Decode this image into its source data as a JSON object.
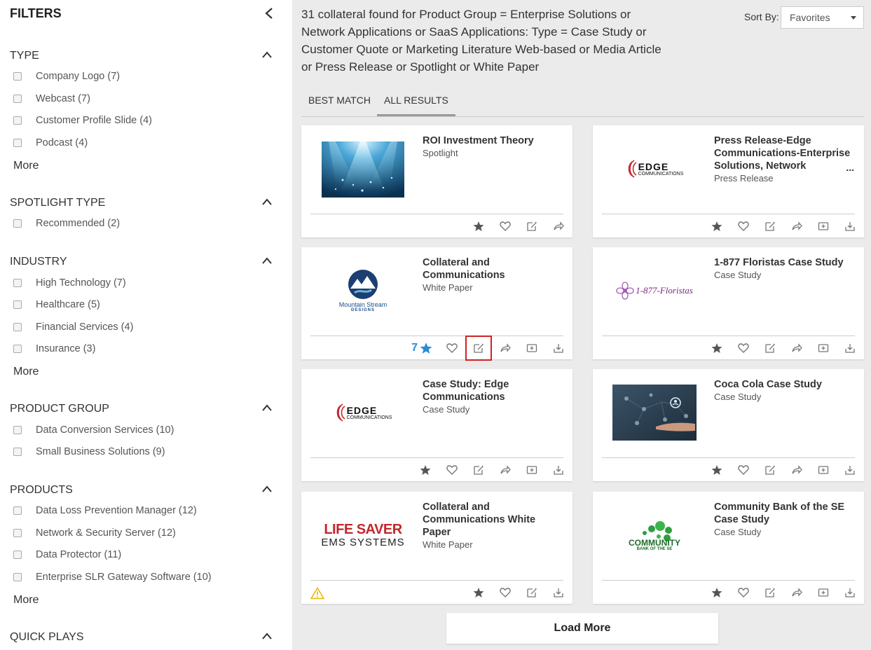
{
  "sidebar": {
    "title": "FILTERS",
    "more_label": "More",
    "sections": [
      {
        "title": "TYPE",
        "options": [
          "Company Logo (7)",
          "Webcast (7)",
          "Customer Profile Slide (4)",
          "Podcast (4)"
        ]
      },
      {
        "title": "SPOTLIGHT TYPE",
        "options": [
          "Recommended (2)"
        ]
      },
      {
        "title": "INDUSTRY",
        "options": [
          "High Technology (7)",
          "Healthcare (5)",
          "Financial Services (4)",
          "Insurance (3)"
        ]
      },
      {
        "title": "PRODUCT GROUP",
        "options": [
          "Data Conversion Services (10)",
          "Small Business Solutions (9)"
        ]
      },
      {
        "title": "PRODUCTS",
        "options": [
          "Data Loss Prevention Manager (12)",
          "Network & Security Server (12)",
          "Data Protector (11)",
          "Enterprise SLR Gateway Software (10)"
        ]
      },
      {
        "title": "QUICK PLAYS",
        "options": []
      }
    ]
  },
  "main": {
    "summary": "31 collateral found for Product Group = Enterprise Solutions or Network Applications or SaaS Applications: Type = Case Study or Customer Quote or Marketing Literature Web-based or Media Article or Press Release or Spotlight or White Paper",
    "sort_label": "Sort By:",
    "sort_value": "Favorites",
    "tabs": [
      "BEST MATCH",
      "ALL RESULTS"
    ],
    "load_more": "Load More"
  },
  "cards": [
    {
      "title": "ROI Investment Theory",
      "type": "Spotlight"
    },
    {
      "title": "Press Release-Edge Communications-Enterprise Solutions, Network",
      "type": "Press Release",
      "ellipsis": "..."
    },
    {
      "title": "Collateral and Communications",
      "type": "White Paper",
      "rating": "7"
    },
    {
      "title": "1-877 Floristas Case Study",
      "type": "Case Study"
    },
    {
      "title": "Case Study: Edge Communications",
      "type": "Case Study"
    },
    {
      "title": "Coca Cola Case Study",
      "type": "Case Study"
    },
    {
      "title": "Collateral and Communications White Paper",
      "type": "White Paper"
    },
    {
      "title": "Community Bank of the SE Case Study",
      "type": "Case Study"
    }
  ],
  "logos": {
    "edge_main": "EDGE",
    "edge_sub": "COMMUNICATIONS",
    "mountain_main": "Mountain Stream",
    "mountain_sub": "DESIGNS",
    "floristas": "1-877-Floristas",
    "lifesaver_main": "LIFE SAVER",
    "lifesaver_sub": "EMS SYSTEMS",
    "community_main": "COMMUNITY",
    "community_sub": "BANK OF THE SE"
  },
  "colors": {
    "accent_blue": "#2a8bd6",
    "highlight_red": "#d32020",
    "edge_red": "#c0282d",
    "warning_yellow": "#e8b400"
  }
}
